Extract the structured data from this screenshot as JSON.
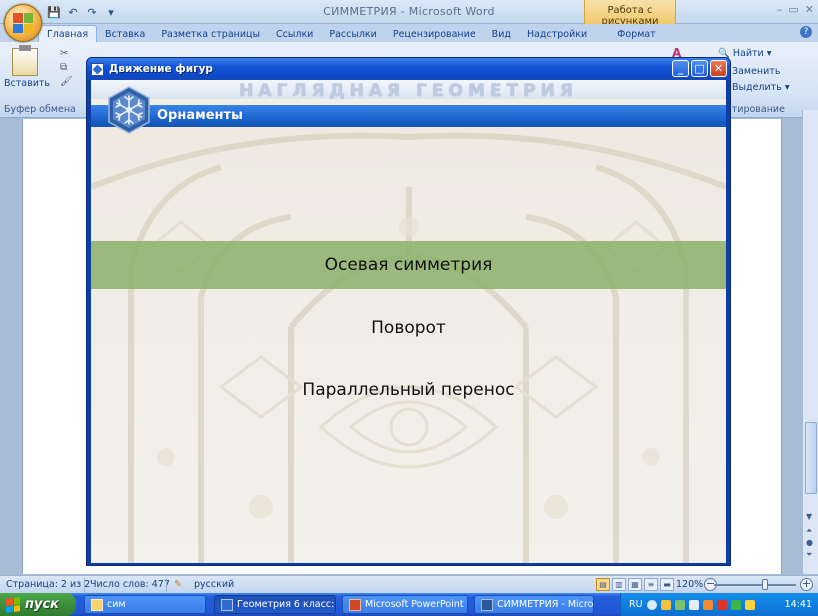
{
  "word": {
    "title": "СИММЕТРИЯ - Microsoft Word",
    "context_group": "Работа с рисунками",
    "win_controls": [
      "–",
      "▭",
      "✕"
    ],
    "tabs": [
      "Главная",
      "Вставка",
      "Разметка страницы",
      "Ссылки",
      "Рассылки",
      "Рецензирование",
      "Вид",
      "Надстройки",
      "Формат"
    ],
    "active_tab": "Главная",
    "ribbon": {
      "paste_label": "Вставить",
      "clipboard_group": "Буфер обмена",
      "find": "Найти",
      "replace": "Заменить",
      "select": "Выделить",
      "editing_group": "ктирование"
    },
    "status": {
      "page": "Страница: 2 из 2",
      "words": "Число слов: 477",
      "language": "русский",
      "zoom": "120%"
    }
  },
  "app": {
    "title": "Движение фигур",
    "header": "НАГЛЯДНАЯ ГЕОМЕТРИЯ",
    "section": "Орнаменты",
    "menu": [
      {
        "label": "Осевая симметрия",
        "selected": true
      },
      {
        "label": "Поворот",
        "selected": false
      },
      {
        "label": "Параллельный перенос",
        "selected": false
      }
    ]
  },
  "taskbar": {
    "start": "пуск",
    "tasks": [
      {
        "label": "сим",
        "active": false
      },
      {
        "label": "Геометрия 6 класс: ...",
        "active": true
      },
      {
        "label": "Microsoft PowerPoint ...",
        "active": false
      },
      {
        "label": "СИММЕТРИЯ - Micros...",
        "active": false
      }
    ],
    "lang": "RU",
    "clock": "14:41"
  },
  "colors": {
    "xp_blue": "#245edb",
    "menu_selected": "#8ab26a",
    "section_bar": "#1c64cf"
  }
}
